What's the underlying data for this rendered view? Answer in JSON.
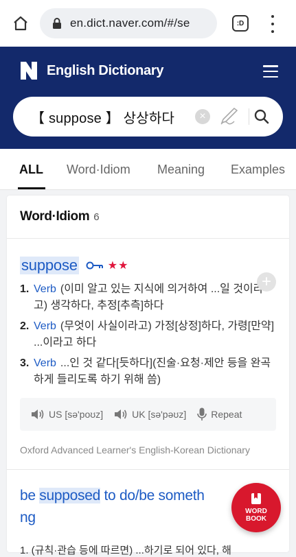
{
  "browser": {
    "url": "en.dict.naver.com/#/se",
    "tab_count": ":D"
  },
  "header": {
    "title": "English Dictionary",
    "search_query": "【 suppose 】 상상하다"
  },
  "tabs": [
    {
      "label": "ALL",
      "active": true
    },
    {
      "label": "Word·Idiom",
      "active": false
    },
    {
      "label": "Meaning",
      "active": false
    },
    {
      "label": "Examples",
      "active": false
    }
  ],
  "section": {
    "heading": "Word·Idiom",
    "count": "6"
  },
  "entry": {
    "word": "suppose",
    "stars": "★★",
    "definitions": [
      {
        "num": "1.",
        "pos": "Verb",
        "text": "(이미 알고 있는 지식에 의거하여 ...일 것이라고) 생각하다, 추정[추측]하다"
      },
      {
        "num": "2.",
        "pos": "Verb",
        "text": "(무엇이 사실이라고) 가정[상정]하다, 가령[만약] ...이라고 하다"
      },
      {
        "num": "3.",
        "pos": "Verb",
        "text": "...인 것 같다[듯하다](진술·요청·제안 등을 완곡하게 들리도록 하기 위해 씀)"
      }
    ],
    "pronunciation": {
      "us": "US [sə'poʊz]",
      "uk": "UK [sə'pəʊz]",
      "repeat": "Repeat"
    },
    "source": "Oxford Advanced Learner's English-Korean Dictionary"
  },
  "entry2": {
    "pre": "be ",
    "hl": "supposed",
    "post": " to do/be someth",
    "line2": "ng",
    "cut_text": "1. (규칙·관습 등에 따르면) ...하기로 되어 있다, 해"
  },
  "fab": {
    "line1": "WORD",
    "line2": "BOOK"
  },
  "colors": {
    "header_bg": "#13296b",
    "link_blue": "#1d5bc4",
    "highlight": "#dfe9f9",
    "star_red": "#e0163c",
    "fab_red": "#d8182d"
  }
}
